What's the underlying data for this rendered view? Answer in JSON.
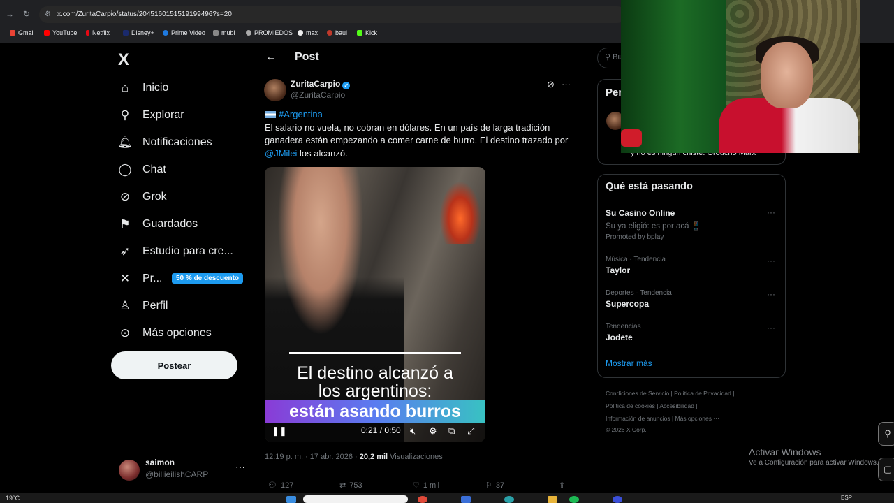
{
  "browser": {
    "url": "x.com/ZuritaCarpio/status/2045160151519199496?s=20",
    "bookmarks": [
      "Gmail",
      "YouTube",
      "Netflix",
      "Disney+",
      "Prime Video",
      "mubi",
      "PROMIEDOS",
      "max",
      "baul",
      "Kick"
    ]
  },
  "sidebar": {
    "logo": "X",
    "items": [
      {
        "label": "Inicio",
        "icon": "home-icon"
      },
      {
        "label": "Explorar",
        "icon": "search-icon"
      },
      {
        "label": "Notificaciones",
        "icon": "bell-icon"
      },
      {
        "label": "Chat",
        "icon": "chat-icon"
      },
      {
        "label": "Grok",
        "icon": "grok-icon"
      },
      {
        "label": "Guardados",
        "icon": "bookmark-icon"
      },
      {
        "label": "Estudio para cre...",
        "icon": "rocket-icon"
      },
      {
        "label": "Pr...",
        "icon": "x-premium-icon"
      },
      {
        "label": "Perfil",
        "icon": "person-icon"
      },
      {
        "label": "Más opciones",
        "icon": "more-circle-icon"
      }
    ],
    "promo_badge": "50 % de descuento",
    "post_button": "Postear",
    "account": {
      "name": "saimon",
      "handle": "@billieilishCARP",
      "more": "···"
    }
  },
  "post": {
    "header_title": "Post",
    "author_name": "ZuritaCarpio",
    "author_handle": "@ZuritaCarpio",
    "hashtag": "#Argentina",
    "text_1": "El salario no vuela, no cobran en dólares. En un país de larga tradición ganadera están empezando a comer carne de burro. El destino trazado por ",
    "mention": "@JMilei",
    "text_2": " los alcanzó.",
    "video": {
      "caption_line1": "El destino alcanzó a",
      "caption_line2": "los argentinos:",
      "caption_highlight": "están asando burros",
      "time": "0:21 / 0:50"
    },
    "meta_time": "12:19 p. m. · 17 abr. 2026 · ",
    "meta_views": "20,2 mil",
    "meta_views_label": " Visualizaciones",
    "actions": {
      "replies": "127",
      "reposts": "753",
      "likes": "1 mil",
      "bookmarks": "37"
    }
  },
  "right": {
    "search_placeholder": "Bu",
    "box1_title": "Per",
    "box1_quote": "y no es ningún chiste. Groucho Marx",
    "trends_title": "Qué está pasando",
    "trends": [
      {
        "context": "",
        "name": "Su Casino Online",
        "sub": "Su ya eligió: es por acá 📱",
        "promo": "Promoted by bplay"
      },
      {
        "context": "Música · Tendencia",
        "name": "Taylor"
      },
      {
        "context": "Deportes · Tendencia",
        "name": "Supercopa"
      },
      {
        "context": "Tendencias",
        "name": "Jodete"
      }
    ],
    "show_more": "Mostrar más",
    "footer_line1": "Condiciones de Servicio  |  Política de Privacidad  |",
    "footer_line2": "Política de cookies  |  Accesibilidad  |",
    "footer_line3": "Información de anuncios  |  Más opciones ···",
    "footer_line4": "© 2026 X Corp."
  },
  "windows": {
    "activate_title": "Activar Windows",
    "activate_sub": "Ve a Configuración para activar Windows.",
    "temp": "19°C",
    "lang": "ESP"
  }
}
